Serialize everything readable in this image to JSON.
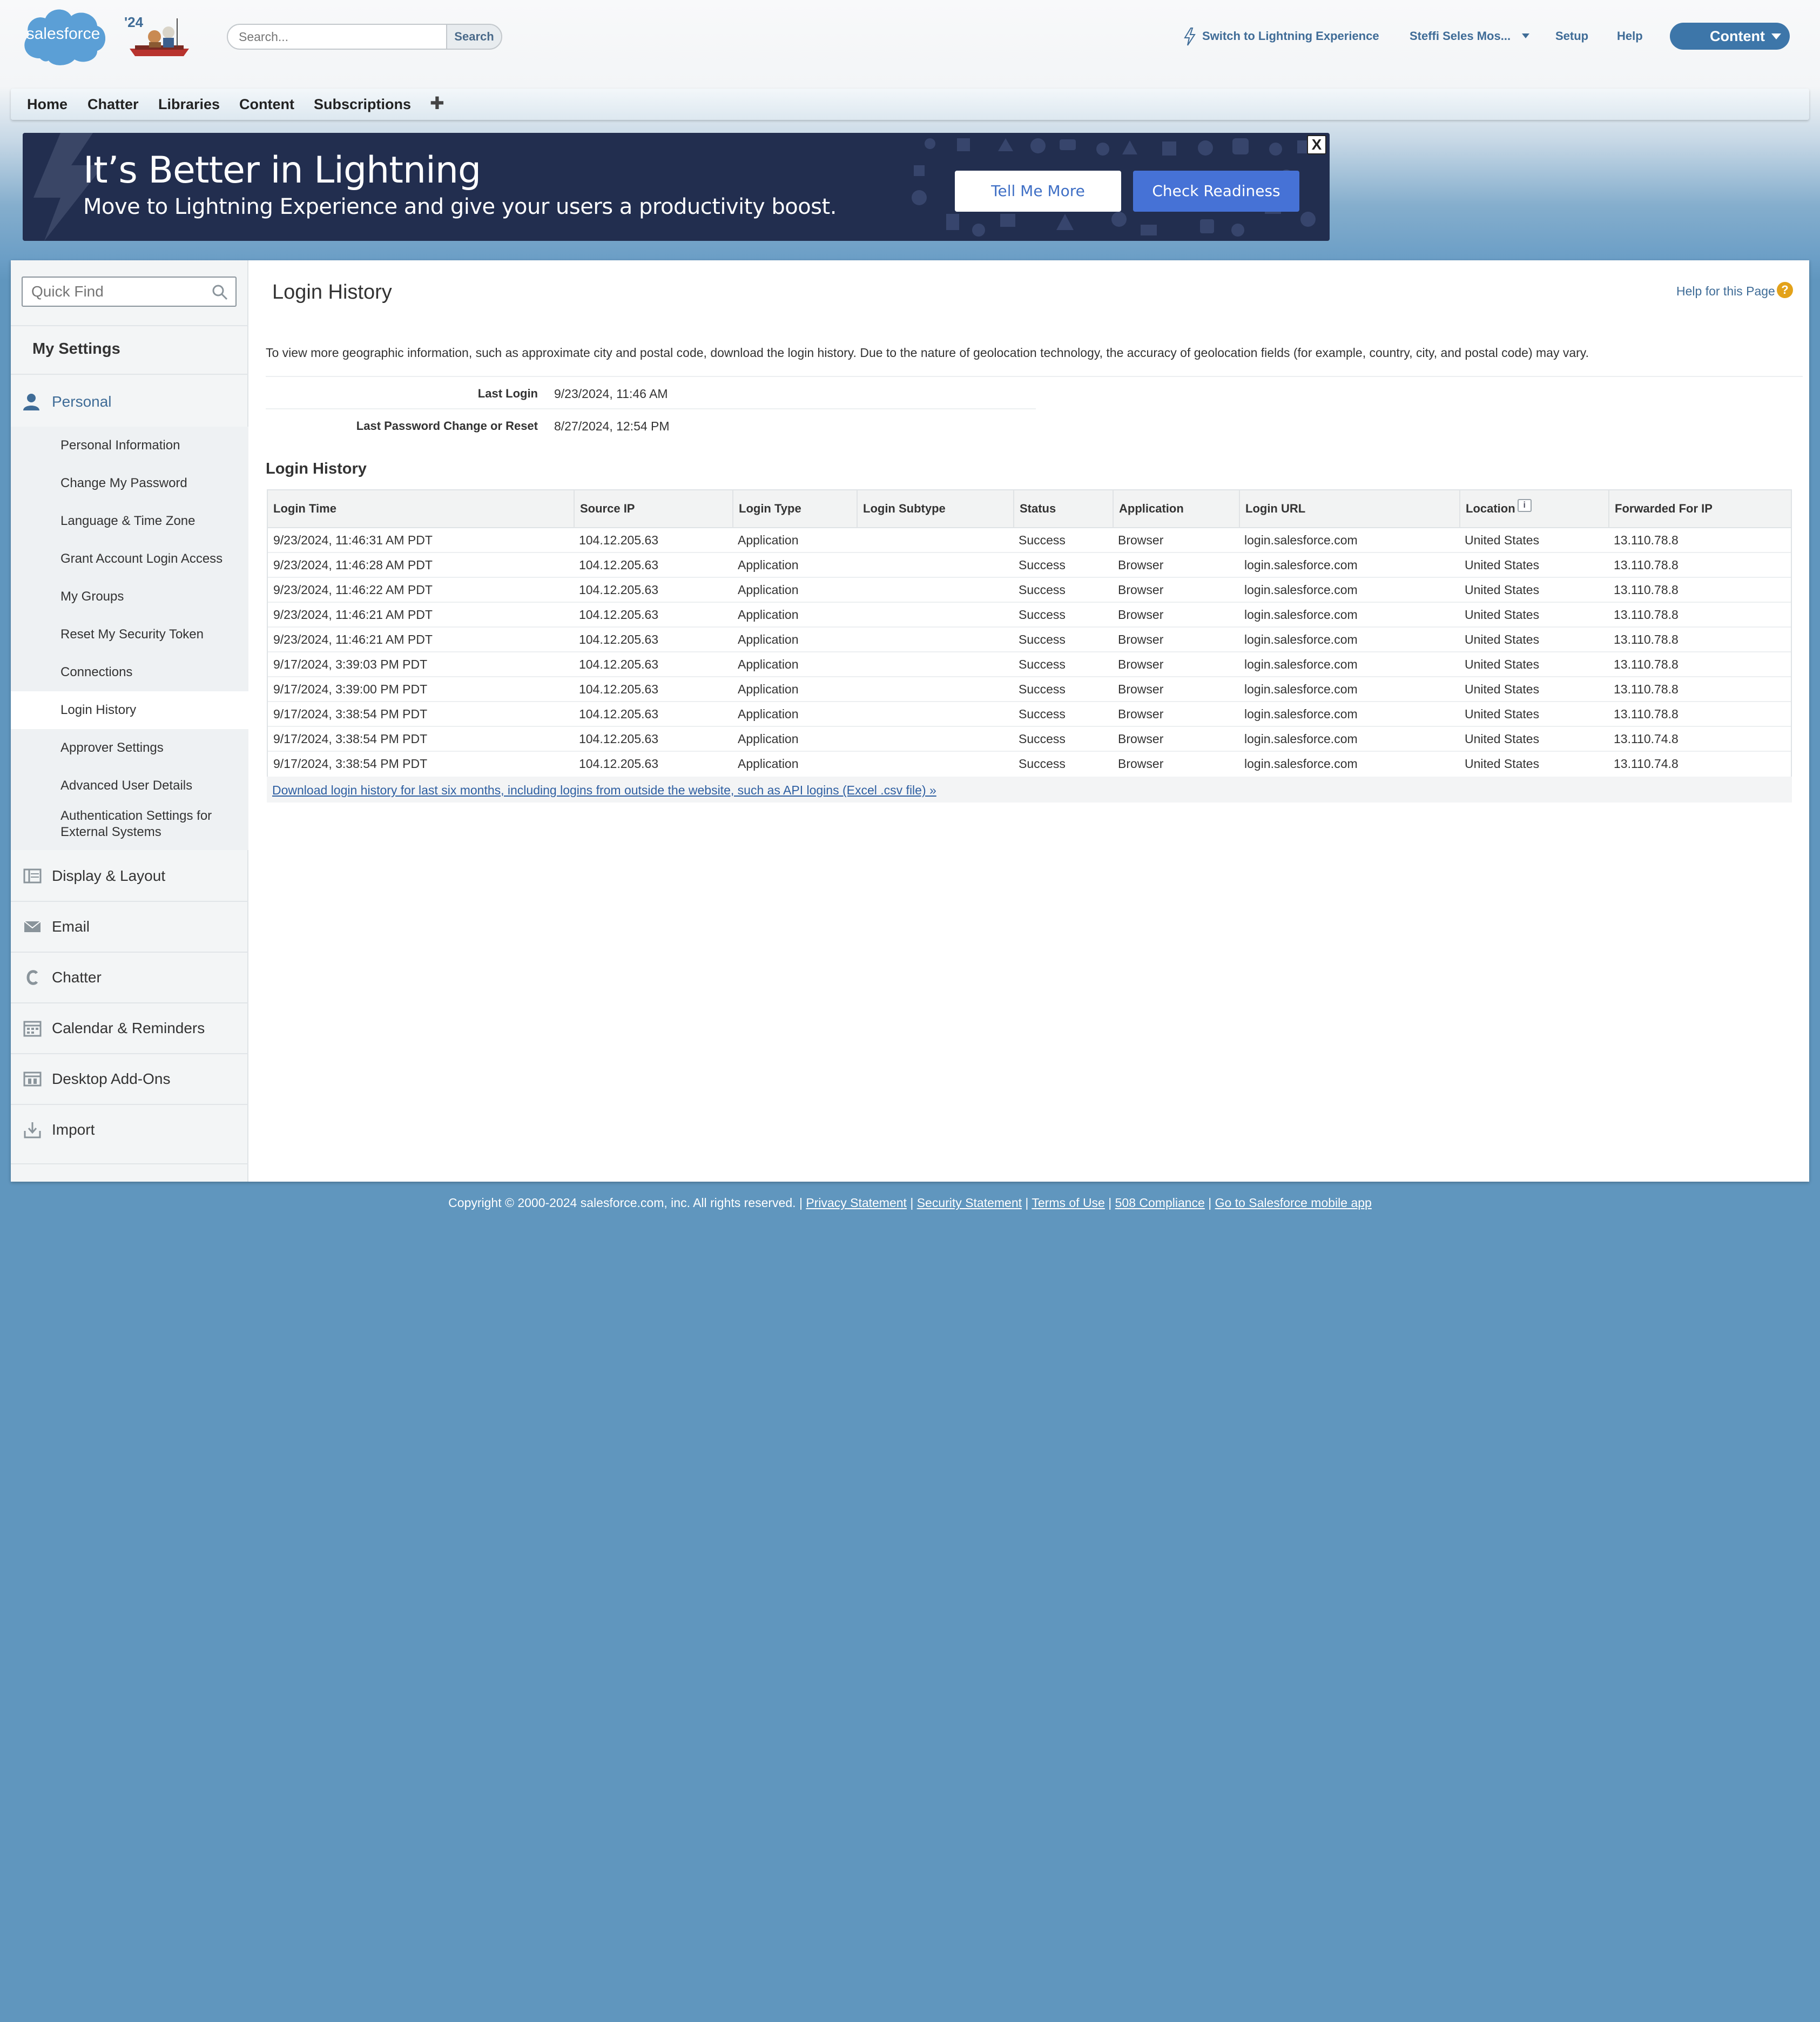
{
  "header": {
    "logo_text": "salesforce",
    "release_year": "'24",
    "search_placeholder": "Search...",
    "search_button": "Search",
    "switch_lightning": "Switch to Lightning Experience",
    "user_menu": "Steffi Seles Mos...",
    "setup": "Setup",
    "help": "Help",
    "app_menu": "Content"
  },
  "tabs": [
    {
      "label": "Home"
    },
    {
      "label": "Chatter"
    },
    {
      "label": "Libraries"
    },
    {
      "label": "Content"
    },
    {
      "label": "Subscriptions"
    },
    {
      "label": "✚"
    }
  ],
  "banner": {
    "title": "It’s Better in Lightning",
    "subtitle": "Move to Lightning Experience and give your users a productivity boost.",
    "tell_me_more": "Tell Me More",
    "check_readiness": "Check Readiness",
    "close": "X"
  },
  "sidebar": {
    "quick_find_placeholder": "Quick Find",
    "my_settings": "My Settings",
    "personal": "Personal",
    "personal_items": [
      {
        "label": "Personal Information"
      },
      {
        "label": "Change My Password"
      },
      {
        "label": "Language & Time Zone"
      },
      {
        "label": "Grant Account Login Access"
      },
      {
        "label": "My Groups"
      },
      {
        "label": "Reset My Security Token"
      },
      {
        "label": "Connections"
      },
      {
        "label": "Login History"
      },
      {
        "label": "Approver Settings"
      },
      {
        "label": "Advanced User Details"
      },
      {
        "label": "Authentication Settings for External Systems"
      }
    ],
    "categories": [
      {
        "label": "Display & Layout"
      },
      {
        "label": "Email"
      },
      {
        "label": "Chatter"
      },
      {
        "label": "Calendar & Reminders"
      },
      {
        "label": "Desktop Add-Ons"
      },
      {
        "label": "Import"
      }
    ]
  },
  "content": {
    "page_title": "Login History",
    "help_link": "Help for this Page",
    "info_text": "To view more geographic information, such as approximate city and postal code, download the login history. Due to the nature of geolocation technology, the accuracy of geolocation fields (for example, country, city, and postal code) may vary.",
    "last_login_label": "Last Login",
    "last_login_value": "9/23/2024, 11:46 AM",
    "last_pw_label": "Last Password Change or Reset",
    "last_pw_value": "8/27/2024, 12:54 PM",
    "section_title": "Login History",
    "columns": [
      "Login Time",
      "Source IP",
      "Login Type",
      "Login Subtype",
      "Status",
      "Application",
      "Login URL",
      "Location",
      "Forwarded For IP"
    ],
    "rows": [
      [
        "9/23/2024, 11:46:31 AM PDT",
        "104.12.205.63",
        "Application",
        "",
        "Success",
        "Browser",
        "login.salesforce.com",
        "United States",
        "13.110.78.8"
      ],
      [
        "9/23/2024, 11:46:28 AM PDT",
        "104.12.205.63",
        "Application",
        "",
        "Success",
        "Browser",
        "login.salesforce.com",
        "United States",
        "13.110.78.8"
      ],
      [
        "9/23/2024, 11:46:22 AM PDT",
        "104.12.205.63",
        "Application",
        "",
        "Success",
        "Browser",
        "login.salesforce.com",
        "United States",
        "13.110.78.8"
      ],
      [
        "9/23/2024, 11:46:21 AM PDT",
        "104.12.205.63",
        "Application",
        "",
        "Success",
        "Browser",
        "login.salesforce.com",
        "United States",
        "13.110.78.8"
      ],
      [
        "9/23/2024, 11:46:21 AM PDT",
        "104.12.205.63",
        "Application",
        "",
        "Success",
        "Browser",
        "login.salesforce.com",
        "United States",
        "13.110.78.8"
      ],
      [
        "9/17/2024, 3:39:03 PM PDT",
        "104.12.205.63",
        "Application",
        "",
        "Success",
        "Browser",
        "login.salesforce.com",
        "United States",
        "13.110.78.8"
      ],
      [
        "9/17/2024, 3:39:00 PM PDT",
        "104.12.205.63",
        "Application",
        "",
        "Success",
        "Browser",
        "login.salesforce.com",
        "United States",
        "13.110.78.8"
      ],
      [
        "9/17/2024, 3:38:54 PM PDT",
        "104.12.205.63",
        "Application",
        "",
        "Success",
        "Browser",
        "login.salesforce.com",
        "United States",
        "13.110.78.8"
      ],
      [
        "9/17/2024, 3:38:54 PM PDT",
        "104.12.205.63",
        "Application",
        "",
        "Success",
        "Browser",
        "login.salesforce.com",
        "United States",
        "13.110.74.8"
      ],
      [
        "9/17/2024, 3:38:54 PM PDT",
        "104.12.205.63",
        "Application",
        "",
        "Success",
        "Browser",
        "login.salesforce.com",
        "United States",
        "13.110.74.8"
      ]
    ],
    "download_link": "Download login history for last six months, including logins from outside the website, such as API logins (Excel .csv file) »"
  },
  "footer": {
    "copyright": "Copyright © 2000-2024 salesforce.com, inc. All rights reserved.",
    "links": [
      {
        "label": "Privacy Statement"
      },
      {
        "label": "Security Statement"
      },
      {
        "label": "Terms of Use"
      },
      {
        "label": "508 Compliance"
      },
      {
        "label": "Go to Salesforce mobile app"
      }
    ]
  },
  "colors": {
    "background": "#6096be",
    "accent": "#3f6c97",
    "banner": "#222e4f",
    "check_readiness": "#4672d6",
    "app_menu": "#3d76a9"
  }
}
